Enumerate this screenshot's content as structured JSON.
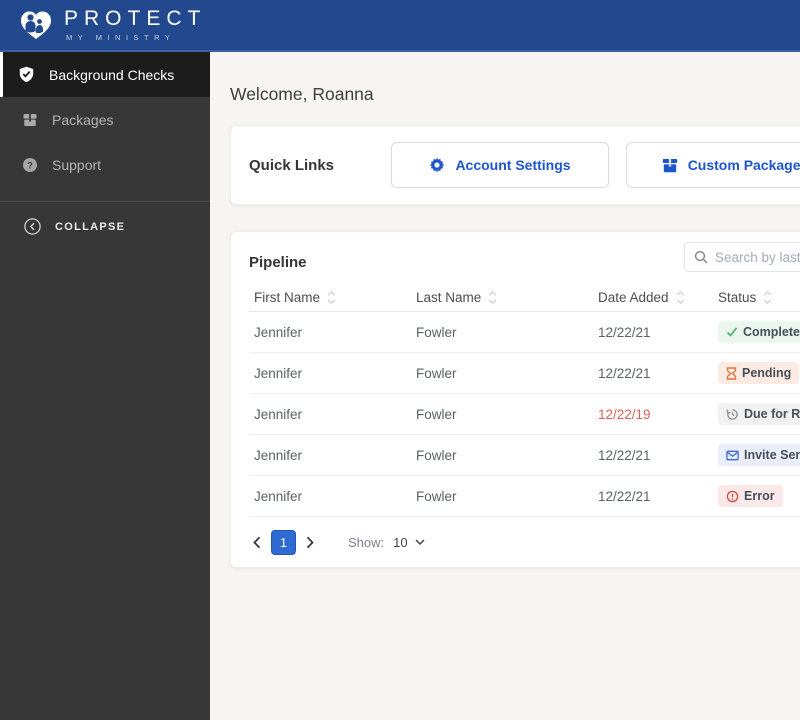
{
  "colors": {
    "header-bg": "#22498e",
    "accent": "#1d56cc",
    "page-bg": "#f7f5f1",
    "sidebar-bg": "#373737",
    "sidebar-active-bg": "#1c1c1c",
    "badge-text": "#474f58",
    "date-alert": "#e06058",
    "page-active-bg": "#2e6ad1",
    "complete-bg": "#eaf6ee",
    "complete-icon": "#4caf6e",
    "pending-bg": "#fcebe2",
    "pending-icon": "#e2733f",
    "rescreen-bg": "#f1f1f2",
    "rescreen-icon": "#8a9097",
    "invite-bg": "#eaeefb",
    "invite-icon": "#3a6bd8",
    "error-bg": "#fbe9e9",
    "error-icon": "#d24848"
  },
  "header": {
    "brand_title": "PROTECT",
    "brand_subtitle": "MY MINISTRY"
  },
  "sidebar": {
    "items": [
      {
        "label": "Background Checks",
        "icon": "shield-check-icon",
        "active": true
      },
      {
        "label": "Packages",
        "icon": "packages-icon",
        "active": false
      },
      {
        "label": "Support",
        "icon": "help-icon",
        "active": false
      }
    ],
    "collapse_label": "COLLAPSE"
  },
  "main": {
    "welcome": "Welcome, Roanna",
    "quick_links": {
      "title": "Quick Links",
      "buttons": [
        {
          "label": "Account Settings",
          "icon": "gear-icon"
        },
        {
          "label": "Custom Packages",
          "icon": "package-icon"
        }
      ]
    },
    "pipeline": {
      "title": "Pipeline",
      "search_placeholder": "Search by last name",
      "columns": [
        "First Name",
        "Last Name",
        "Date Added",
        "Status"
      ],
      "rows": [
        {
          "first_name": "Jennifer",
          "last_name": "Fowler",
          "date_added": "12/22/21",
          "date_alert": false,
          "status": {
            "label": "Complete",
            "type": "complete",
            "icon": "check-icon"
          }
        },
        {
          "first_name": "Jennifer",
          "last_name": "Fowler",
          "date_added": "12/22/21",
          "date_alert": false,
          "status": {
            "label": "Pending",
            "type": "pending",
            "icon": "hourglass-icon"
          }
        },
        {
          "first_name": "Jennifer",
          "last_name": "Fowler",
          "date_added": "12/22/19",
          "date_alert": true,
          "status": {
            "label": "Due for Rescreen",
            "type": "rescreen",
            "icon": "history-icon"
          }
        },
        {
          "first_name": "Jennifer",
          "last_name": "Fowler",
          "date_added": "12/22/21",
          "date_alert": false,
          "status": {
            "label": "Invite Sent",
            "type": "invite",
            "icon": "envelope-icon"
          }
        },
        {
          "first_name": "Jennifer",
          "last_name": "Fowler",
          "date_added": "12/22/21",
          "date_alert": false,
          "status": {
            "label": "Error",
            "type": "error",
            "icon": "error-icon"
          }
        }
      ],
      "pagination": {
        "current_page": "1",
        "show_label": "Show:",
        "page_size": "10"
      }
    }
  }
}
